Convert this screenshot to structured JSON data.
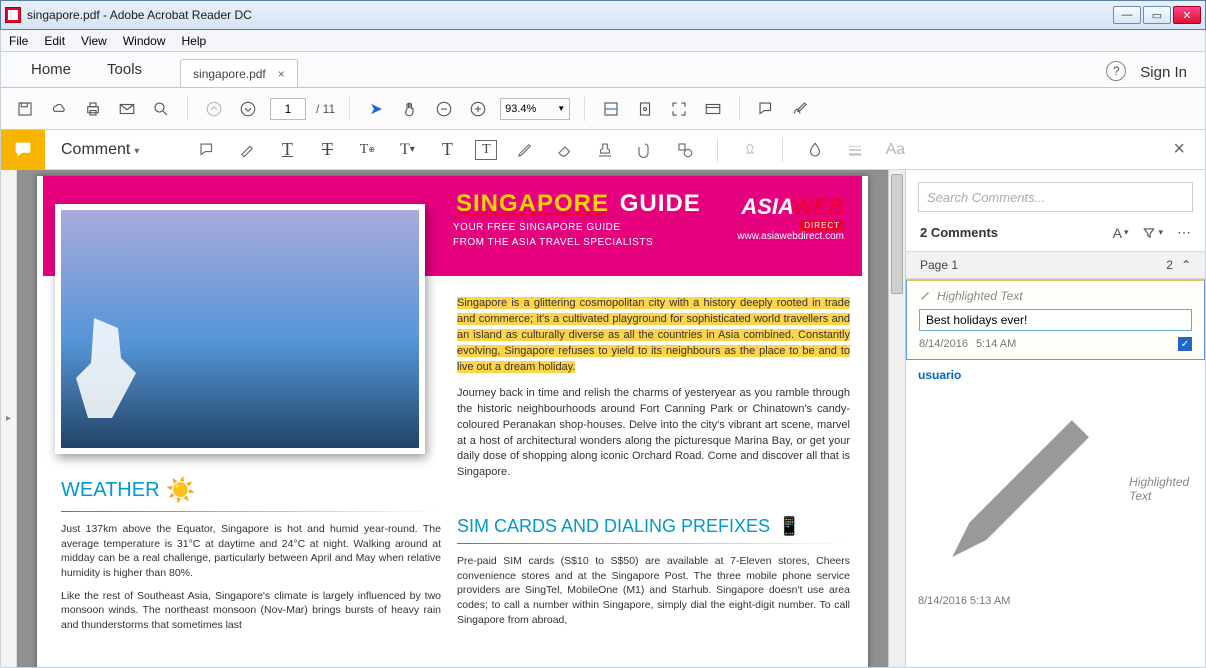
{
  "window": {
    "title": "singapore.pdf - Adobe Acrobat Reader DC"
  },
  "menubar": [
    "File",
    "Edit",
    "View",
    "Window",
    "Help"
  ],
  "tabs": {
    "home": "Home",
    "tools": "Tools",
    "doc": "singapore.pdf",
    "signin": "Sign In"
  },
  "toolbar": {
    "page_current": "1",
    "page_total": "/ 11",
    "zoom": "93.4%"
  },
  "commentbar": {
    "label": "Comment"
  },
  "document": {
    "title_highlight": "SINGAPORE",
    "title_rest": " GUIDE",
    "sub1": "YOUR FREE SINGAPORE GUIDE",
    "sub2": "FROM THE ASIA TRAVEL SPECIALISTS",
    "brand_a": "ASIA",
    "brand_b": "WEB",
    "brand_tag": "DIRECT",
    "brand_url": "www.asiawebdirect.com",
    "para_hl": "Singapore is a glittering cosmopolitan city with a history deeply rooted in trade and commerce; it's a cultivated playground for sophisticated world travellers and an island as culturally diverse as all the countries in Asia combined. Constantly evolving, Singapore refuses to yield to its neighbours as the place to be and to live out a dream holiday.",
    "para2": "Journey back in time and relish the charms of yesteryear as you ramble through the historic neighbourhoods around Fort Canning Park or Chinatown's candy-coloured Peranakan shop-houses. Delve into the city's vibrant art scene, marvel at a host of architectural wonders along the picturesque Marina Bay, or get your daily dose of shopping along iconic Orchard Road. Come and discover all that is Singapore.",
    "weather_h": "WEATHER",
    "weather_p1": "Just 137km above the Equator, Singapore is hot and humid year-round. The average temperature is 31°C at daytime and 24°C at night. Walking around at midday can be a real challenge, particularly between April and May when relative humidity is higher than 80%.",
    "weather_p2": "Like the rest of Southeast Asia, Singapore's climate is largely influenced by two monsoon winds. The northeast monsoon (Nov-Mar) brings bursts of heavy rain and thunderstorms that sometimes last",
    "sim_h": "SIM CARDS AND DIALING PREFIXES",
    "sim_p": "Pre-paid SIM cards (S$10 to S$50) are available at 7-Eleven stores, Cheers convenience stores and at the Singapore Post. The three mobile phone service providers are SingTel, MobileOne (M1) and Starhub. Singapore doesn't use area codes; to call a number within Singapore, simply dial the eight-digit number. To call Singapore from abroad,"
  },
  "panel": {
    "search_placeholder": "Search Comments...",
    "count": "2 Comments",
    "page_label": "Page 1",
    "page_count": "2",
    "c1_type": "Highlighted Text",
    "c1_text": "Best holidays ever!",
    "c1_date": "8/14/2016",
    "c1_time": "5:14 AM",
    "c2_user": "usuario",
    "c2_type": "Highlighted Text",
    "c2_date": "8/14/2016",
    "c2_time": "5:13 AM"
  }
}
